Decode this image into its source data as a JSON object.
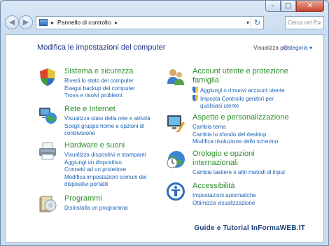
{
  "window": {
    "caption_buttons": [
      "–",
      "□",
      "✕"
    ]
  },
  "toolbar": {
    "back_icon": "back-arrow-icon",
    "forward_icon": "forward-arrow-icon",
    "address_separator": "▸",
    "address_text": "Pannello di controllo",
    "address_separator_2": "▸",
    "dropdown_glyph": "▾",
    "refresh_glyph": "↻",
    "search_placeholder": "Cerca nel P..."
  },
  "content": {
    "heading": "Modifica le impostazioni del computer",
    "view_by_label": "Visualizza per:",
    "view_by_value": "Categoria ▾"
  },
  "left_categories": [
    {
      "title": "Sistema e sicurezza",
      "links": [
        "Rivedi lo stato del computer",
        "Esegui backup del computer",
        "Trova e risolvi problemi"
      ]
    },
    {
      "title": "Rete e Internet",
      "links": [
        "Visualizza stato della rete e attività",
        "Scegli gruppo home e opzioni di",
        "condivisione"
      ]
    },
    {
      "title": "Hardware e suoni",
      "links": [
        "Visualizza dispositivi e stampanti",
        "Aggiungi un dispositivo",
        "Connetti ad un proiettore",
        "Modifica impostazioni comuni dei",
        "dispositivi portatili"
      ]
    },
    {
      "title": "Programmi",
      "links": [
        "Disinstalla un programma"
      ]
    }
  ],
  "right_categories": [
    {
      "title_line1": "Account utente e protezione",
      "title_line2": "famiglia",
      "links": [
        "Aggiungi o rimuovi account utente",
        "Imposta Controllo genitori per",
        "qualsiasi utente"
      ]
    },
    {
      "title": "Aspetto e personalizzazione",
      "links": [
        "Cambia tema",
        "Cambia lo sfondo del desktop",
        "Modifica risoluzione dello schermo"
      ]
    },
    {
      "title_line1": "Orologio e opzioni",
      "title_line2": "internazionali",
      "links": [
        "Cambia tastiere o altri metodi di input"
      ]
    },
    {
      "title": "Accessibilità",
      "links": [
        "Impostazioni automatiche",
        "Ottimizza visualizzazione"
      ]
    }
  ],
  "watermark": "Guide e Tutorial InFormaWEB.IT",
  "colors": {
    "heading": "#1e3287",
    "category_title": "#2d8f2d",
    "link": "#1b62b3"
  }
}
